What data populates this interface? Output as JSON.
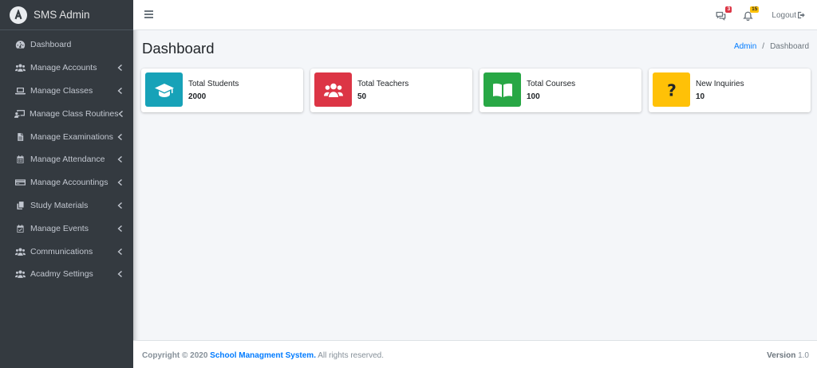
{
  "brand": {
    "title": "SMS Admin"
  },
  "sidebar": {
    "items": [
      {
        "label": "Dashboard",
        "icon": "tachometer-icon",
        "has_submenu": false
      },
      {
        "label": "Manage Accounts",
        "icon": "users-icon",
        "has_submenu": true
      },
      {
        "label": "Manage Classes",
        "icon": "laptop-icon",
        "has_submenu": true
      },
      {
        "label": "Manage Class Routines",
        "icon": "chalkboard-teacher-icon",
        "has_submenu": true
      },
      {
        "label": "Manage Examinations",
        "icon": "file-alt-icon",
        "has_submenu": true
      },
      {
        "label": "Manage Attendance",
        "icon": "calendar-icon",
        "has_submenu": true
      },
      {
        "label": "Manage Accountings",
        "icon": "credit-card-icon",
        "has_submenu": true
      },
      {
        "label": "Study Materials",
        "icon": "copy-icon",
        "has_submenu": true
      },
      {
        "label": "Manage Events",
        "icon": "calendar-check-icon",
        "has_submenu": true
      },
      {
        "label": "Communications",
        "icon": "users-icon",
        "has_submenu": true
      },
      {
        "label": "Acadmy Settings",
        "icon": "users-icon",
        "has_submenu": true
      }
    ]
  },
  "topbar": {
    "messages_badge": "3",
    "notifications_badge": "15",
    "logout_label": "Logout"
  },
  "page": {
    "title": "Dashboard"
  },
  "breadcrumb": {
    "home": "Admin",
    "separator": "/",
    "current": "Dashboard"
  },
  "info_boxes": [
    {
      "label": "Total Students",
      "value": "2000",
      "color": "#17a2b8",
      "icon": "graduation-cap-icon"
    },
    {
      "label": "Total Teachers",
      "value": "50",
      "color": "#dc3545",
      "icon": "users-icon"
    },
    {
      "label": "Total Courses",
      "value": "100",
      "color": "#28a745",
      "icon": "book-open-icon"
    },
    {
      "label": "New Inquiries",
      "value": "10",
      "color": "#ffc107",
      "icon": "question-icon"
    }
  ],
  "footer": {
    "copyright": "Copyright © 2020",
    "org": "School Managment System.",
    "rights": "All rights reserved.",
    "version_label": "Version",
    "version": "1.0"
  }
}
